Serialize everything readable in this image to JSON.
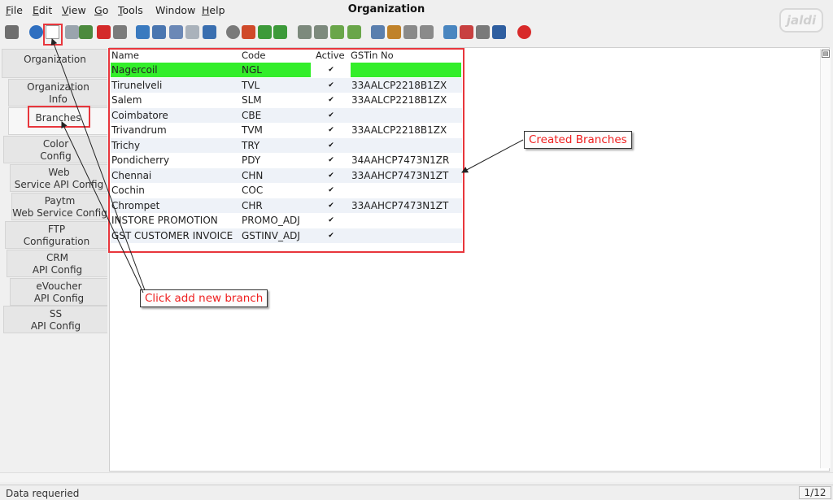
{
  "menu": {
    "items": [
      {
        "mnemonic": "F",
        "rest": "ile"
      },
      {
        "mnemonic": "E",
        "rest": "dit"
      },
      {
        "mnemonic": "V",
        "rest": "iew"
      },
      {
        "mnemonic": "G",
        "rest": "o"
      },
      {
        "mnemonic": "T",
        "rest": "ools"
      },
      {
        "mnemonic": "",
        "rest": "Window"
      },
      {
        "mnemonic": "H",
        "rest": "elp"
      }
    ]
  },
  "window": {
    "title": "Organization"
  },
  "logo": {
    "text": "jaldi"
  },
  "toolbar": {
    "icons": [
      {
        "name": "undo-icon",
        "color": "#6f6f6f"
      },
      {
        "name": "help-icon",
        "color": "#2f6fc0",
        "shape": "circle"
      },
      {
        "name": "new-record-icon",
        "color": "#ffffff",
        "shape": "newdoc"
      },
      {
        "name": "copy-record-icon",
        "color": "#9aa4ad"
      },
      {
        "name": "refresh-record-icon",
        "color": "#4c8a3e"
      },
      {
        "name": "delete-icon",
        "color": "#d42a2a"
      },
      {
        "name": "save-icon",
        "color": "#7b7b7b"
      },
      {
        "name": "requery-icon",
        "color": "#3a7abf"
      },
      {
        "name": "find-icon",
        "color": "#4a76b0"
      },
      {
        "name": "attachment-icon",
        "color": "#6b88b6"
      },
      {
        "name": "chat-icon",
        "color": "#aab2bb"
      },
      {
        "name": "grid-toggle-icon",
        "color": "#3a6fb0"
      },
      {
        "name": "history-icon",
        "color": "#7a7a7a",
        "shape": "circle"
      },
      {
        "name": "home-icon",
        "color": "#d04a2a"
      },
      {
        "name": "parent-record-icon",
        "color": "#3d9a3a"
      },
      {
        "name": "detail-record-icon",
        "color": "#3d9a3a"
      },
      {
        "name": "first-record-icon",
        "color": "#7d8a7d"
      },
      {
        "name": "previous-record-icon",
        "color": "#7d8a7d"
      },
      {
        "name": "next-record-icon",
        "color": "#6aa64a"
      },
      {
        "name": "last-record-icon",
        "color": "#6aa64a"
      },
      {
        "name": "report-icon",
        "color": "#5a7fae"
      },
      {
        "name": "archive-icon",
        "color": "#c0822a"
      },
      {
        "name": "print-preview-icon",
        "color": "#8a8a8a"
      },
      {
        "name": "print-icon",
        "color": "#8a8a8a"
      },
      {
        "name": "zoom-across-icon",
        "color": "#4a86c0"
      },
      {
        "name": "workflow-icon",
        "color": "#c84040"
      },
      {
        "name": "product-info-icon",
        "color": "#7a7a7a"
      },
      {
        "name": "process-icon",
        "color": "#2f5fa0"
      },
      {
        "name": "close-window-icon",
        "color": "#d82a2a",
        "shape": "circle"
      }
    ]
  },
  "tabs": [
    {
      "label": "Organization"
    },
    {
      "label": "Organization\nInfo"
    },
    {
      "label": "Branches"
    },
    {
      "label": "Color\nConfig"
    },
    {
      "label": "Web\nService API Config"
    },
    {
      "label": "Paytm\nWeb Service Config"
    },
    {
      "label": "FTP\nConfiguration"
    },
    {
      "label": "CRM\nAPI Config"
    },
    {
      "label": "eVoucher\nAPI Config"
    },
    {
      "label": "SS\nAPI Config"
    }
  ],
  "grid": {
    "headers": {
      "name": "Name",
      "code": "Code",
      "active": "Active",
      "gstin": "GSTin No"
    },
    "checkbox_glyph": "✔",
    "rows": [
      {
        "name": "Nagercoil",
        "code": "NGL",
        "gstin": ""
      },
      {
        "name": "Tirunelveli",
        "code": "TVL",
        "gstin": "33AALCP2218B1ZX"
      },
      {
        "name": "Salem",
        "code": "SLM",
        "gstin": "33AALCP2218B1ZX"
      },
      {
        "name": "Coimbatore",
        "code": "CBE",
        "gstin": ""
      },
      {
        "name": "Trivandrum",
        "code": "TVM",
        "gstin": "33AALCP2218B1ZX"
      },
      {
        "name": "Trichy",
        "code": "TRY",
        "gstin": ""
      },
      {
        "name": "Pondicherry",
        "code": "PDY",
        "gstin": "34AAHCP7473N1ZR"
      },
      {
        "name": "Chennai",
        "code": "CHN",
        "gstin": "33AAHCP7473N1ZT"
      },
      {
        "name": "Cochin",
        "code": "COC",
        "gstin": ""
      },
      {
        "name": "Chrompet",
        "code": "CHR",
        "gstin": "33AAHCP7473N1ZT"
      },
      {
        "name": "INSTORE PROMOTION",
        "code": "PROMO_ADJ",
        "gstin": ""
      },
      {
        "name": "GST CUSTOMER INVOICE",
        "code": "GSTINV_ADJ",
        "gstin": ""
      }
    ],
    "highlight_color": "#33ee2a"
  },
  "annotations": {
    "created_branches": "Created Branches",
    "click_add_new": "Click add new branch"
  },
  "status": {
    "message": "Data requeried",
    "page": "1/12"
  },
  "colors": {
    "annotation_red": "#e8363c",
    "callout_text": "#ef1f1f"
  }
}
